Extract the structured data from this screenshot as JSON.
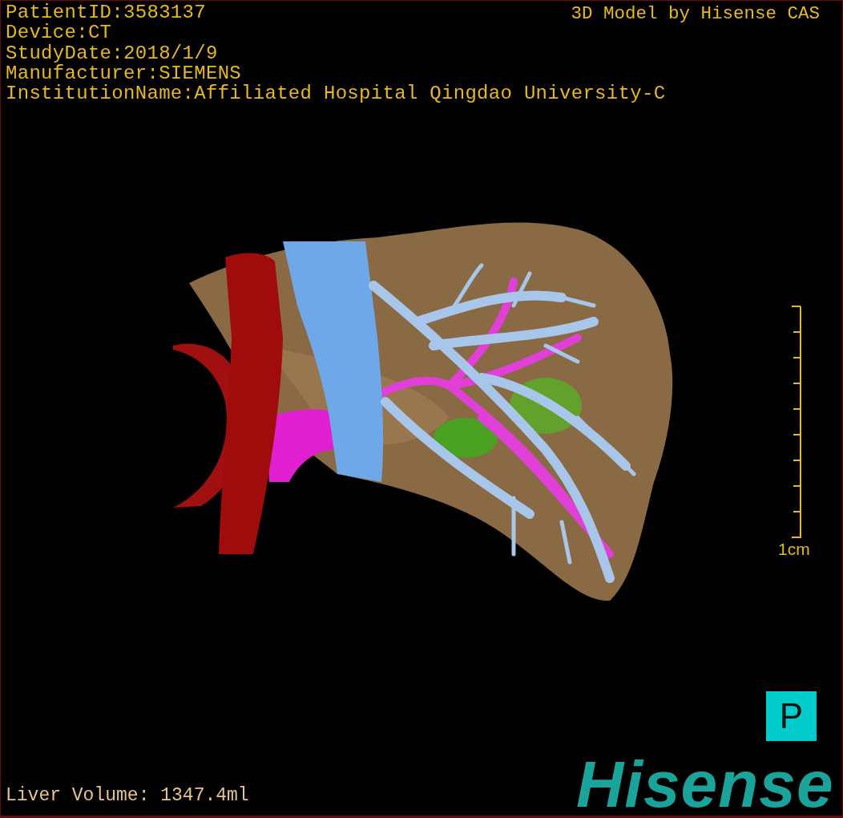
{
  "info": [
    "PatientID:3583137",
    "Device:CT",
    "StudyDate:2018/1/9",
    "Manufacturer:SIEMENS",
    "InstitutionName:Affiliated Hospital Qingdao University-C"
  ],
  "credit": "3D Model by Hisense CAS",
  "scale_bar": {
    "label": "1cm"
  },
  "orientation": {
    "label": "P"
  },
  "liver_volume": "Liver Volume: 1347.4ml",
  "logo": "Hisense"
}
